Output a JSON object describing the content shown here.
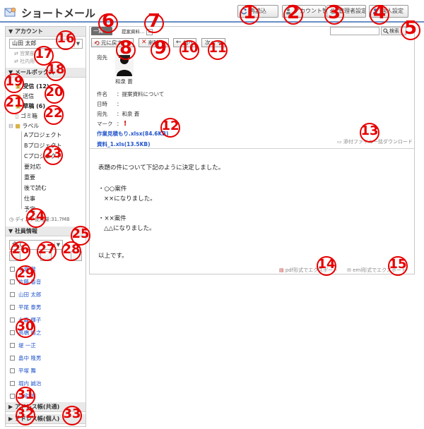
{
  "header": {
    "title": "ショートメール",
    "buttons": [
      {
        "label": "再読込"
      },
      {
        "label": "アカウント管理"
      },
      {
        "label": "管理者設定"
      },
      {
        "label": "個人設定"
      }
    ]
  },
  "sidebar": {
    "account_header": "▼ アカウント",
    "account_select": "山田 太郎",
    "account_links": [
      "営業部",
      "社内用"
    ],
    "mailbox_header": "▼ メールボックス",
    "folders": [
      {
        "label": "受信 (12)"
      },
      {
        "label": "送信"
      },
      {
        "label": "草稿 (6)"
      },
      {
        "label": "ゴミ箱"
      },
      {
        "label": "ラベル"
      }
    ],
    "labels": [
      "Aプロジェクト",
      "Bプロジェクト",
      "Cプロジェクト",
      "要対応",
      "重要",
      "後で読む",
      "仕事",
      "予定"
    ],
    "storage": "ディスク使用量:31.7MB",
    "employee_header": "▼ 社員情報",
    "employee_select": "全て",
    "employees": [
      "小倉 敦",
      "佐藤 香音",
      "山田 太郎",
      "平尾 泰男",
      "大森 輝子",
      "高橋 裕之",
      "堤 一正",
      "畠中 隆男",
      "平塚 舞",
      "堀内 誠治",
      "三宅 亮"
    ],
    "address_shared": "▶ アドレス帳(共通)",
    "address_personal": "▶ アドレス帳(個人)"
  },
  "main": {
    "tab_active": "一覧",
    "tab_message": "提案資料…",
    "search_placeholder": "",
    "search_button": "検索",
    "toolbar": {
      "back": "元に戻す",
      "delete": "削除",
      "prev": "前へ",
      "next": "次へ"
    },
    "recipient_label": "宛先",
    "avatar_name": "和泉 蒼",
    "meta": [
      {
        "label": "件名",
        "value": "：提案資料について"
      },
      {
        "label": "日時",
        "value": "："
      },
      {
        "label": "宛先",
        "value": "：和泉 蒼"
      },
      {
        "label": "マーク",
        "value": "："
      }
    ],
    "attachments": [
      "作業見積もり.xlsx(84.6KB)",
      "資料_1.xls(13.5KB)"
    ],
    "download_all": "添付ファイル一括ダウンロード",
    "body": [
      "表題の件について下記のように決定しました。",
      "・○○案件",
      "××になりました。",
      "・××案件",
      "△△になりました。",
      "以上です。"
    ],
    "export_pdf": "pdf形式でエクスポート",
    "export_eml": "eml形式でエクスポート"
  },
  "markers": [
    "1",
    "2",
    "3",
    "4",
    "5",
    "6",
    "7",
    "8",
    "9",
    "10",
    "11",
    "12",
    "13",
    "14",
    "15",
    "16",
    "17",
    "18",
    "19",
    "20",
    "21",
    "22",
    "23",
    "24",
    "25",
    "26",
    "27",
    "28",
    "29",
    "30",
    "31",
    "32",
    "33"
  ],
  "colors": {
    "marker": "#e60000",
    "accent": "#6a8ec7",
    "link": "#2255cc"
  }
}
